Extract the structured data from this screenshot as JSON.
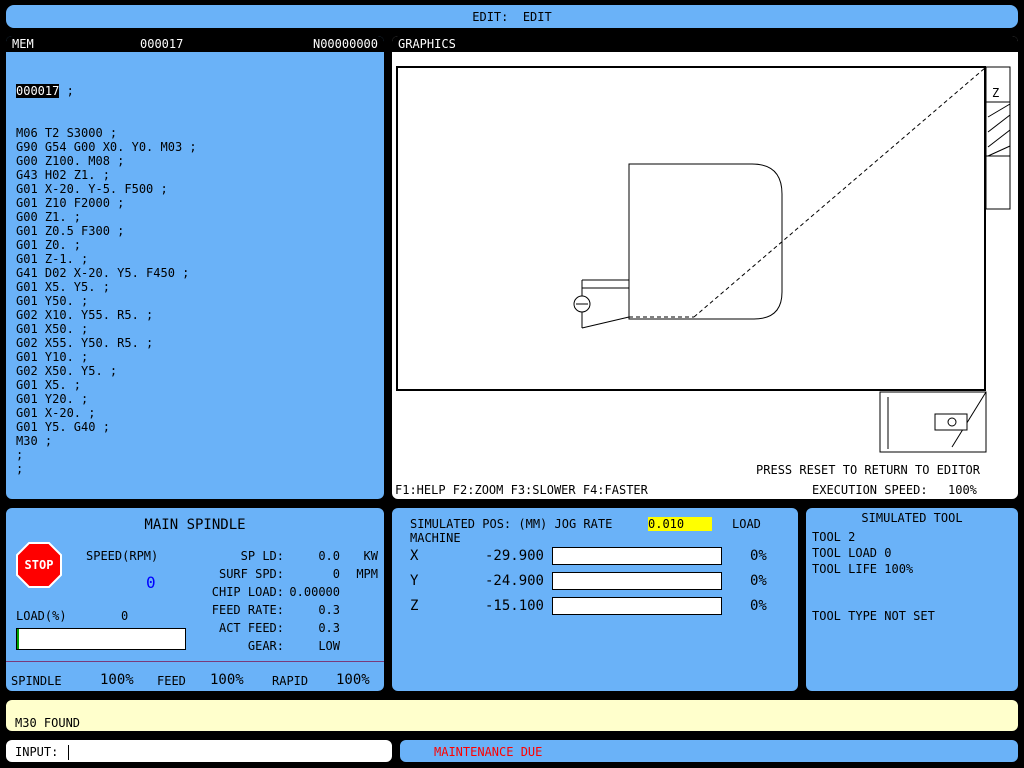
{
  "top_bar": {
    "title": "EDIT:  EDIT"
  },
  "program": {
    "header_mode": "MEM",
    "header_program": "000017",
    "header_line": "N00000000",
    "first_line_highlight": "000017",
    "first_line_rest": " ;",
    "lines": [
      "M06 T2 S3000 ;",
      "G90 G54 G00 X0. Y0. M03 ;",
      "G00 Z100. M08 ;",
      "G43 H02 Z1. ;",
      "G01 X-20. Y-5. F500 ;",
      "G01 Z10 F2000 ;",
      "G00 Z1. ;",
      "G01 Z0.5 F300 ;",
      "G01 Z0. ;",
      "G01 Z-1. ;",
      "G41 D02 X-20. Y5. F450 ;",
      "G01 X5. Y5. ;",
      "G01 Y50. ;",
      "G02 X10. Y55. R5. ;",
      "G01 X50. ;",
      "G02 X55. Y50. R5. ;",
      "G01 Y10. ;",
      "G02 X50. Y5. ;",
      "G01 X5. ;",
      "G01 Y20. ;",
      "G01 X-20. ;",
      "G01 Y5. G40 ;",
      "M30 ;",
      ";",
      ";"
    ]
  },
  "graphics": {
    "title": "GRAPHICS",
    "z_label": "Z",
    "reset_message": "PRESS RESET TO RETURN TO EDITOR",
    "function_keys": "F1:HELP F2:ZOOM F3:SLOWER F4:FASTER",
    "execution_speed_label": "EXECUTION SPEED:",
    "execution_speed_value": "100%"
  },
  "spindle": {
    "title": "MAIN SPINDLE",
    "stop_label": "STOP",
    "speed_label": "SPEED(RPM)",
    "speed_value": "0",
    "load_label": "LOAD(%)",
    "load_value": "0",
    "stats": [
      {
        "label": "SP LD:",
        "value": "0.0",
        "unit": "KW"
      },
      {
        "label": "SURF SPD:",
        "value": "0",
        "unit": "MPM"
      },
      {
        "label": "CHIP LOAD:",
        "value": "0.00000",
        "unit": ""
      },
      {
        "label": "FEED RATE:",
        "value": "0.3",
        "unit": ""
      },
      {
        "label": "ACT FEED:",
        "value": "0.3",
        "unit": ""
      },
      {
        "label": "GEAR:",
        "value": "LOW",
        "unit": ""
      }
    ],
    "overrides": {
      "spindle_label": "SPINDLE",
      "spindle_value": "100%",
      "feed_label": "FEED",
      "feed_value": "100%",
      "rapid_label": "RAPID",
      "rapid_value": "100%"
    }
  },
  "position": {
    "header": "SIMULATED POS: (MM) JOG RATE",
    "jog_rate": "0.010",
    "load_label": "LOAD",
    "machine_label": "MACHINE",
    "axes": [
      {
        "axis": "X",
        "value": "-29.900",
        "load": "0%"
      },
      {
        "axis": "Y",
        "value": "-24.900",
        "load": "0%"
      },
      {
        "axis": "Z",
        "value": "-15.100",
        "load": "0%"
      }
    ]
  },
  "tool": {
    "title": "SIMULATED TOOL",
    "tool_line": "TOOL 2",
    "load_line": "TOOL LOAD 0",
    "life_line": "TOOL LIFE 100%",
    "type_line": "TOOL TYPE NOT SET"
  },
  "message": {
    "text": "M30 FOUND"
  },
  "input": {
    "label": "INPUT:",
    "value": ""
  },
  "status": {
    "text": "MAINTENANCE DUE",
    "color": "#ff0000"
  },
  "colors": {
    "panel": "#6ab2f8",
    "message_bg": "#ffffcc",
    "jog_highlight": "#ffff00",
    "speed_value": "#0000ff"
  }
}
